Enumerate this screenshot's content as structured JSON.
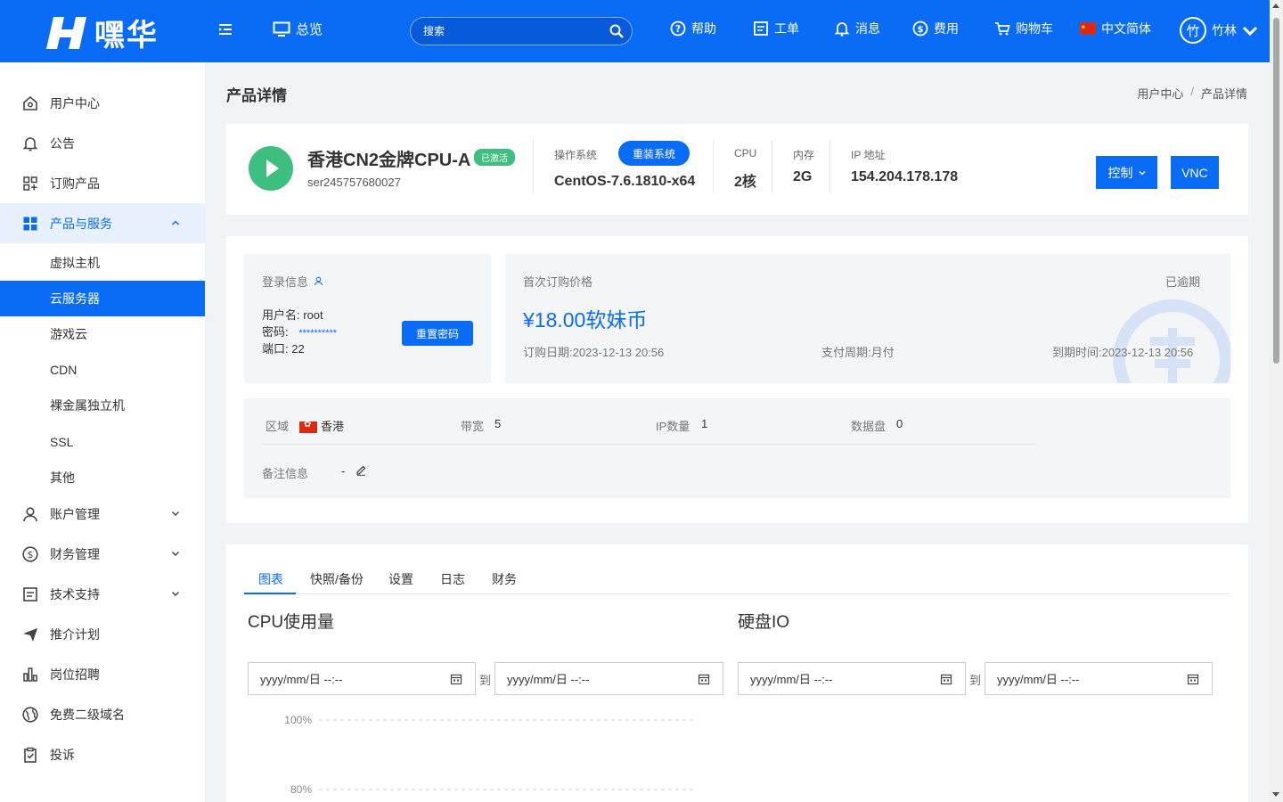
{
  "header": {
    "brand": "嘿华",
    "nav": {
      "overview": "总览",
      "help": "帮助",
      "tickets": "工单",
      "messages": "消息",
      "billing": "费用",
      "cart": "购物车",
      "language": "中文简体",
      "avatar_char": "竹",
      "username": "竹林"
    },
    "search": {
      "placeholder": "搜索"
    }
  },
  "sidebar": {
    "items": [
      {
        "label": "用户中心",
        "icon": "home-icon"
      },
      {
        "label": "公告",
        "icon": "bell-icon"
      },
      {
        "label": "订购产品",
        "icon": "grid-plus-icon"
      },
      {
        "label": "产品与服务",
        "icon": "grid-icon"
      },
      {
        "label": "账户管理",
        "icon": "user-icon"
      },
      {
        "label": "财务管理",
        "icon": "dollar-icon"
      },
      {
        "label": "技术支持",
        "icon": "ticket-icon"
      },
      {
        "label": "推介计划",
        "icon": "send-icon"
      },
      {
        "label": "岗位招聘",
        "icon": "chart-icon"
      },
      {
        "label": "免费二级域名",
        "icon": "globe-icon"
      },
      {
        "label": "投诉",
        "icon": "clipboard-icon"
      }
    ],
    "sub_items": [
      "虚拟主机",
      "云服务器",
      "游戏云",
      "CDN",
      "裸金属独立机",
      "SSL",
      "其他"
    ]
  },
  "page": {
    "title": "产品详情",
    "breadcrumb": [
      "用户中心",
      "/",
      "产品详情"
    ]
  },
  "product": {
    "name": "香港CN2金牌CPU-A",
    "status": "已激活",
    "id": "ser245757680027",
    "os_label": "操作系统",
    "reinstall_label": "重装系统",
    "os": "CentOS-7.6.1810-x64",
    "cpu_label": "CPU",
    "cpu": "2核",
    "mem_label": "内存",
    "mem": "2G",
    "ip_label": "IP 地址",
    "ip": "154.204.178.178",
    "control_label": "控制",
    "vnc_label": "VNC"
  },
  "login": {
    "title": "登录信息",
    "username_label": "用户名:",
    "username": "root",
    "password_label": "密码:",
    "password": "**********",
    "port_label": "端口:",
    "port": "22",
    "reset_label": "重置密码"
  },
  "billing": {
    "title": "首次订购价格",
    "status": "已逾期",
    "price": "¥18.00软妹币",
    "order_date": "订购日期:2023-12-13 20:56",
    "cycle": "支付周期:月付",
    "expire": "到期时间:2023-12-13 20:56"
  },
  "details": {
    "region_label": "区域",
    "region": "香港",
    "bandwidth_label": "带宽",
    "bandwidth": "5",
    "ip_count_label": "IP数量",
    "ip_count": "1",
    "disk_label": "数据盘",
    "disk": "0",
    "note_label": "备注信息",
    "note": "-"
  },
  "tabs": [
    "图表",
    "快照/备份",
    "设置",
    "日志",
    "财务"
  ],
  "charts": {
    "cpu_title": "CPU使用量",
    "disk_title": "硬盘IO",
    "date_placeholder": "yyyy/mm/日 --:--",
    "to": "到"
  },
  "chart_data": {
    "type": "line",
    "title": "CPU使用量",
    "y_ticks": [
      "100%",
      "80%"
    ],
    "ylim": [
      0,
      100
    ],
    "series": [],
    "grid": true
  },
  "colors": {
    "primary": "#0a6cf5",
    "success": "#3fbf7f"
  }
}
